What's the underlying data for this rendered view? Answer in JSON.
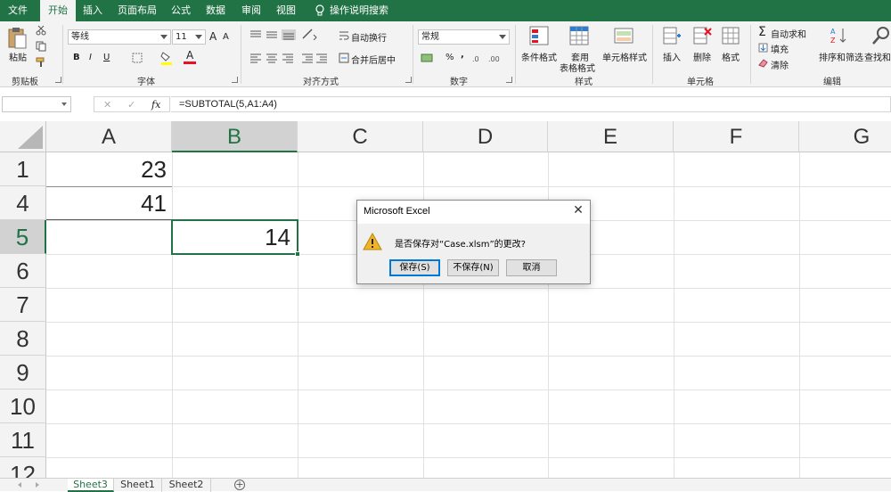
{
  "ribbon_tabs": [
    "文件",
    "开始",
    "插入",
    "页面布局",
    "公式",
    "数据",
    "审阅",
    "视图",
    "操作说明搜索"
  ],
  "active_tab": "开始",
  "groups": {
    "clipboard": {
      "label": "剪贴板",
      "paste": "粘贴"
    },
    "font": {
      "label": "字体",
      "font_name": "等线",
      "font_size": "11",
      "bold": "B",
      "italic": "I",
      "underline": "U",
      "grow": "A",
      "shrink": "A",
      "font_color": "A",
      "fill_icon": "paint-bucket"
    },
    "alignment": {
      "label": "对齐方式",
      "wrap": "自动换行",
      "merge": "合并后居中"
    },
    "number": {
      "label": "数字",
      "format": "常规",
      "percent": "%",
      "comma": ","
    },
    "styles": {
      "label": "样式",
      "conditional": "条件格式",
      "table_line1": "套用",
      "table_line2": "表格格式",
      "cell_styles": "单元格样式"
    },
    "cells": {
      "label": "单元格",
      "insert": "插入",
      "delete": "删除",
      "format": "格式"
    },
    "editing": {
      "label": "编辑",
      "autosum": "自动求和",
      "fill": "填充",
      "clear": "清除",
      "sort": "排序和筛选",
      "find": "查找和"
    }
  },
  "formula_bar": {
    "name_box": "",
    "cancel": "✕",
    "enter": "✓",
    "fx": "fx",
    "formula": "=SUBTOTAL(5,A1:A4)"
  },
  "grid": {
    "columns": [
      "A",
      "B",
      "C",
      "D",
      "E",
      "F",
      "G"
    ],
    "selected_column": "B",
    "rows": [
      "1",
      "4",
      "5",
      "6",
      "7",
      "8",
      "9",
      "10",
      "11",
      "12"
    ],
    "selected_row": "5",
    "cells": {
      "A1": "23",
      "A4": "41",
      "B5": "14"
    },
    "selected_cell": "B5"
  },
  "sheets": {
    "tabs": [
      "Sheet3",
      "Sheet1",
      "Sheet2"
    ],
    "active": "Sheet3",
    "add": "+"
  },
  "dialog": {
    "title": "Microsoft Excel",
    "message": "是否保存对“Case.xlsm”的更改?",
    "buttons": {
      "save": "保存(S)",
      "dont_save": "不保存(N)",
      "cancel": "取消"
    }
  },
  "colors": {
    "accent": "#217346",
    "dialog_default": "#0078d7",
    "warning": "#f0b429"
  }
}
